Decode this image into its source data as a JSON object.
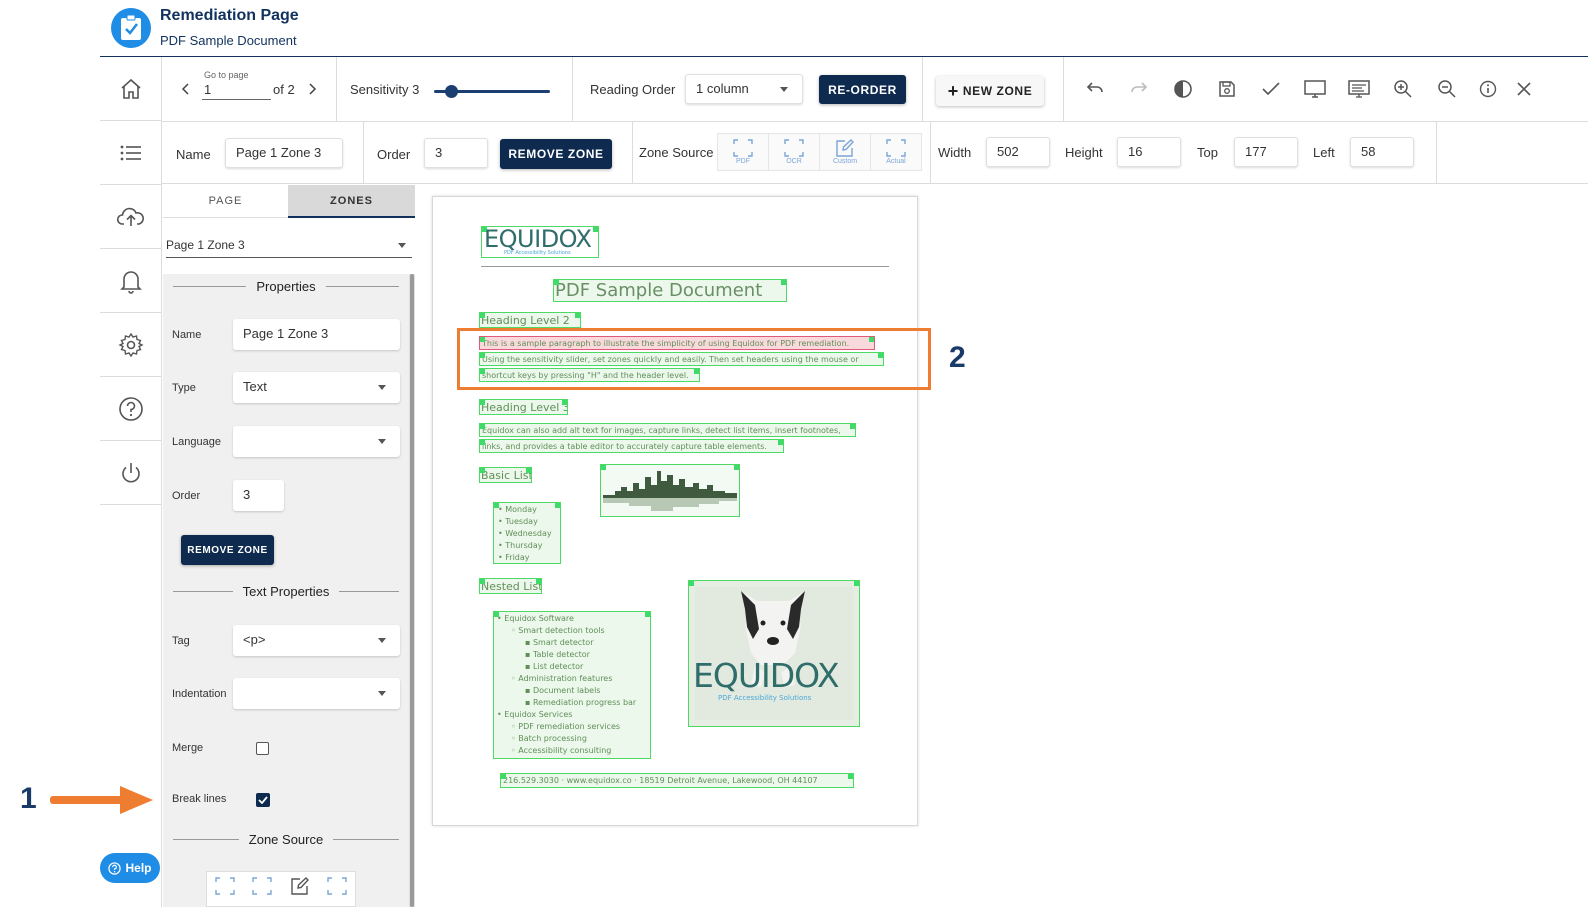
{
  "header": {
    "title": "Remediation Page",
    "subtitle": "PDF Sample Document"
  },
  "nav": [
    "home-icon",
    "list-icon",
    "cloud-upload-icon",
    "bell-icon",
    "gear-icon",
    "help-circle-icon",
    "power-icon"
  ],
  "toolbar": {
    "go_to_page_label": "Go to page",
    "page_value": "1",
    "page_of": "of 2",
    "sensitivity_label": "Sensitivity 3",
    "sensitivity_level": 0.15,
    "reading_order_label": "Reading Order",
    "reading_order_value": "1 column",
    "reorder_label": "RE-ORDER",
    "new_zone_label": "NEW ZONE"
  },
  "zone_bar": {
    "name_label": "Name",
    "name_value": "Page 1 Zone 3",
    "order_label": "Order",
    "order_value": "3",
    "remove_label": "REMOVE ZONE",
    "zone_source_label": "Zone Source",
    "sources": [
      "PDF",
      "OCR",
      "Custom",
      "Actual"
    ],
    "width_label": "Width",
    "width_value": "502",
    "height_label": "Height",
    "height_value": "16",
    "top_label": "Top",
    "top_value": "177",
    "left_label": "Left",
    "left_value": "58"
  },
  "panel": {
    "tabs": [
      "PAGE",
      "ZONES"
    ],
    "zone_select": "Page 1 Zone 3",
    "properties_title": "Properties",
    "name_label": "Name",
    "name_value": "Page 1 Zone 3",
    "type_label": "Type",
    "type_value": "Text",
    "language_label": "Language",
    "language_value": "",
    "order_label": "Order",
    "order_value": "3",
    "remove_label": "REMOVE ZONE",
    "text_properties_title": "Text Properties",
    "tag_label": "Tag",
    "tag_value": "<p>",
    "indentation_label": "Indentation",
    "indentation_value": "",
    "merge_label": "Merge",
    "merge_checked": false,
    "break_lines_label": "Break lines",
    "break_lines_checked": true,
    "zone_source_title": "Zone Source",
    "help_label": "Help"
  },
  "document": {
    "logo_text": "EQUIDOX",
    "logo_tagline": "PDF Accessibility Solutions",
    "title": "PDF Sample Document",
    "heading2": "Heading Level 2",
    "para1": [
      "This is a sample paragraph to illustrate the simplicity of using Equidox for PDF remediation.",
      "Using the sensitivity slider, set zones quickly and easily.  Then set headers using the mouse or",
      "shortcut keys by pressing \"H\" and the header level."
    ],
    "heading3": "Heading Level 3",
    "para2": [
      "Equidox can also add alt text for images, capture links, detect list items, insert footnotes,",
      "links, and provides a table editor to accurately capture table elements."
    ],
    "basic_list_title": "Basic List",
    "basic_list": [
      "Monday",
      "Tuesday",
      "Wednesday",
      "Thursday",
      "Friday"
    ],
    "nested_list_title": "Nested List",
    "nested_list": [
      {
        "level": 1,
        "text": "Equidox Software"
      },
      {
        "level": 2,
        "text": "Smart detection tools"
      },
      {
        "level": 3,
        "text": "Smart detector"
      },
      {
        "level": 3,
        "text": "Table detector"
      },
      {
        "level": 3,
        "text": "List detector"
      },
      {
        "level": 2,
        "text": "Administration features"
      },
      {
        "level": 3,
        "text": "Document labels"
      },
      {
        "level": 3,
        "text": "Remediation progress bar"
      },
      {
        "level": 1,
        "text": "Equidox Services"
      },
      {
        "level": 2,
        "text": "PDF remediation services"
      },
      {
        "level": 2,
        "text": "Batch processing"
      },
      {
        "level": 2,
        "text": "Accessibility consulting"
      }
    ],
    "image_logo_text": "EQUIDOX",
    "image_logo_tagline": "PDF Accessibility Solutions",
    "footer": "216.529.3030 · www.equidox.co · 18519 Detroit Avenue, Lakewood, OH 44107"
  },
  "annotations": {
    "marker1": "1",
    "marker2": "2"
  },
  "colors": {
    "navy": "#0e2a4f",
    "accent_blue": "#1f8ce6",
    "orange": "#ee7d31",
    "zone_green": "#4cd964"
  }
}
